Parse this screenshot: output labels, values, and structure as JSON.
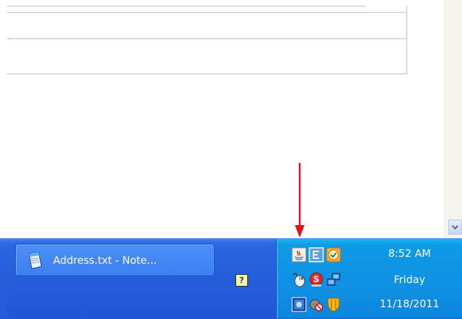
{
  "taskbar": {
    "window_button_label": "Address.txt - Note..."
  },
  "tray": {
    "icons": [
      "java-icon",
      "e-app-icon",
      "clock-sync-icon",
      "mouse-icon",
      "s-app-icon",
      "network-icon",
      "grid-app-icon",
      "no-sound-icon",
      "shield-icon"
    ]
  },
  "clock": {
    "time": "8:52 AM",
    "day": "Friday",
    "date": "11/18/2011"
  },
  "colors": {
    "taskbar_blue": "#245edb",
    "tray_blue": "#0f9ae6",
    "arrow_red": "#e0101a"
  }
}
